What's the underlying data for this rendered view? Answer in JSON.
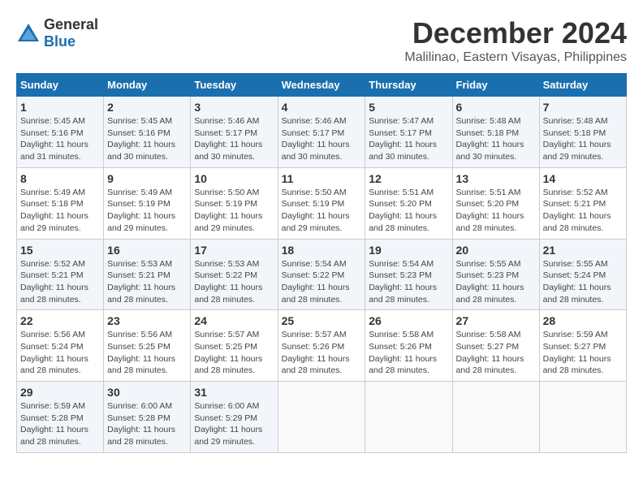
{
  "logo": {
    "general": "General",
    "blue": "Blue"
  },
  "title": "December 2024",
  "location": "Malilinao, Eastern Visayas, Philippines",
  "days_of_week": [
    "Sunday",
    "Monday",
    "Tuesday",
    "Wednesday",
    "Thursday",
    "Friday",
    "Saturday"
  ],
  "weeks": [
    [
      {
        "day": "1",
        "sunrise": "5:45 AM",
        "sunset": "5:16 PM",
        "daylight": "11 hours and 31 minutes."
      },
      {
        "day": "2",
        "sunrise": "5:45 AM",
        "sunset": "5:16 PM",
        "daylight": "11 hours and 30 minutes."
      },
      {
        "day": "3",
        "sunrise": "5:46 AM",
        "sunset": "5:17 PM",
        "daylight": "11 hours and 30 minutes."
      },
      {
        "day": "4",
        "sunrise": "5:46 AM",
        "sunset": "5:17 PM",
        "daylight": "11 hours and 30 minutes."
      },
      {
        "day": "5",
        "sunrise": "5:47 AM",
        "sunset": "5:17 PM",
        "daylight": "11 hours and 30 minutes."
      },
      {
        "day": "6",
        "sunrise": "5:48 AM",
        "sunset": "5:18 PM",
        "daylight": "11 hours and 30 minutes."
      },
      {
        "day": "7",
        "sunrise": "5:48 AM",
        "sunset": "5:18 PM",
        "daylight": "11 hours and 29 minutes."
      }
    ],
    [
      {
        "day": "8",
        "sunrise": "5:49 AM",
        "sunset": "5:18 PM",
        "daylight": "11 hours and 29 minutes."
      },
      {
        "day": "9",
        "sunrise": "5:49 AM",
        "sunset": "5:19 PM",
        "daylight": "11 hours and 29 minutes."
      },
      {
        "day": "10",
        "sunrise": "5:50 AM",
        "sunset": "5:19 PM",
        "daylight": "11 hours and 29 minutes."
      },
      {
        "day": "11",
        "sunrise": "5:50 AM",
        "sunset": "5:19 PM",
        "daylight": "11 hours and 29 minutes."
      },
      {
        "day": "12",
        "sunrise": "5:51 AM",
        "sunset": "5:20 PM",
        "daylight": "11 hours and 28 minutes."
      },
      {
        "day": "13",
        "sunrise": "5:51 AM",
        "sunset": "5:20 PM",
        "daylight": "11 hours and 28 minutes."
      },
      {
        "day": "14",
        "sunrise": "5:52 AM",
        "sunset": "5:21 PM",
        "daylight": "11 hours and 28 minutes."
      }
    ],
    [
      {
        "day": "15",
        "sunrise": "5:52 AM",
        "sunset": "5:21 PM",
        "daylight": "11 hours and 28 minutes."
      },
      {
        "day": "16",
        "sunrise": "5:53 AM",
        "sunset": "5:21 PM",
        "daylight": "11 hours and 28 minutes."
      },
      {
        "day": "17",
        "sunrise": "5:53 AM",
        "sunset": "5:22 PM",
        "daylight": "11 hours and 28 minutes."
      },
      {
        "day": "18",
        "sunrise": "5:54 AM",
        "sunset": "5:22 PM",
        "daylight": "11 hours and 28 minutes."
      },
      {
        "day": "19",
        "sunrise": "5:54 AM",
        "sunset": "5:23 PM",
        "daylight": "11 hours and 28 minutes."
      },
      {
        "day": "20",
        "sunrise": "5:55 AM",
        "sunset": "5:23 PM",
        "daylight": "11 hours and 28 minutes."
      },
      {
        "day": "21",
        "sunrise": "5:55 AM",
        "sunset": "5:24 PM",
        "daylight": "11 hours and 28 minutes."
      }
    ],
    [
      {
        "day": "22",
        "sunrise": "5:56 AM",
        "sunset": "5:24 PM",
        "daylight": "11 hours and 28 minutes."
      },
      {
        "day": "23",
        "sunrise": "5:56 AM",
        "sunset": "5:25 PM",
        "daylight": "11 hours and 28 minutes."
      },
      {
        "day": "24",
        "sunrise": "5:57 AM",
        "sunset": "5:25 PM",
        "daylight": "11 hours and 28 minutes."
      },
      {
        "day": "25",
        "sunrise": "5:57 AM",
        "sunset": "5:26 PM",
        "daylight": "11 hours and 28 minutes."
      },
      {
        "day": "26",
        "sunrise": "5:58 AM",
        "sunset": "5:26 PM",
        "daylight": "11 hours and 28 minutes."
      },
      {
        "day": "27",
        "sunrise": "5:58 AM",
        "sunset": "5:27 PM",
        "daylight": "11 hours and 28 minutes."
      },
      {
        "day": "28",
        "sunrise": "5:59 AM",
        "sunset": "5:27 PM",
        "daylight": "11 hours and 28 minutes."
      }
    ],
    [
      {
        "day": "29",
        "sunrise": "5:59 AM",
        "sunset": "5:28 PM",
        "daylight": "11 hours and 28 minutes."
      },
      {
        "day": "30",
        "sunrise": "6:00 AM",
        "sunset": "5:28 PM",
        "daylight": "11 hours and 28 minutes."
      },
      {
        "day": "31",
        "sunrise": "6:00 AM",
        "sunset": "5:29 PM",
        "daylight": "11 hours and 29 minutes."
      },
      null,
      null,
      null,
      null
    ]
  ],
  "labels": {
    "sunrise": "Sunrise: ",
    "sunset": "Sunset: ",
    "daylight": "Daylight: "
  }
}
